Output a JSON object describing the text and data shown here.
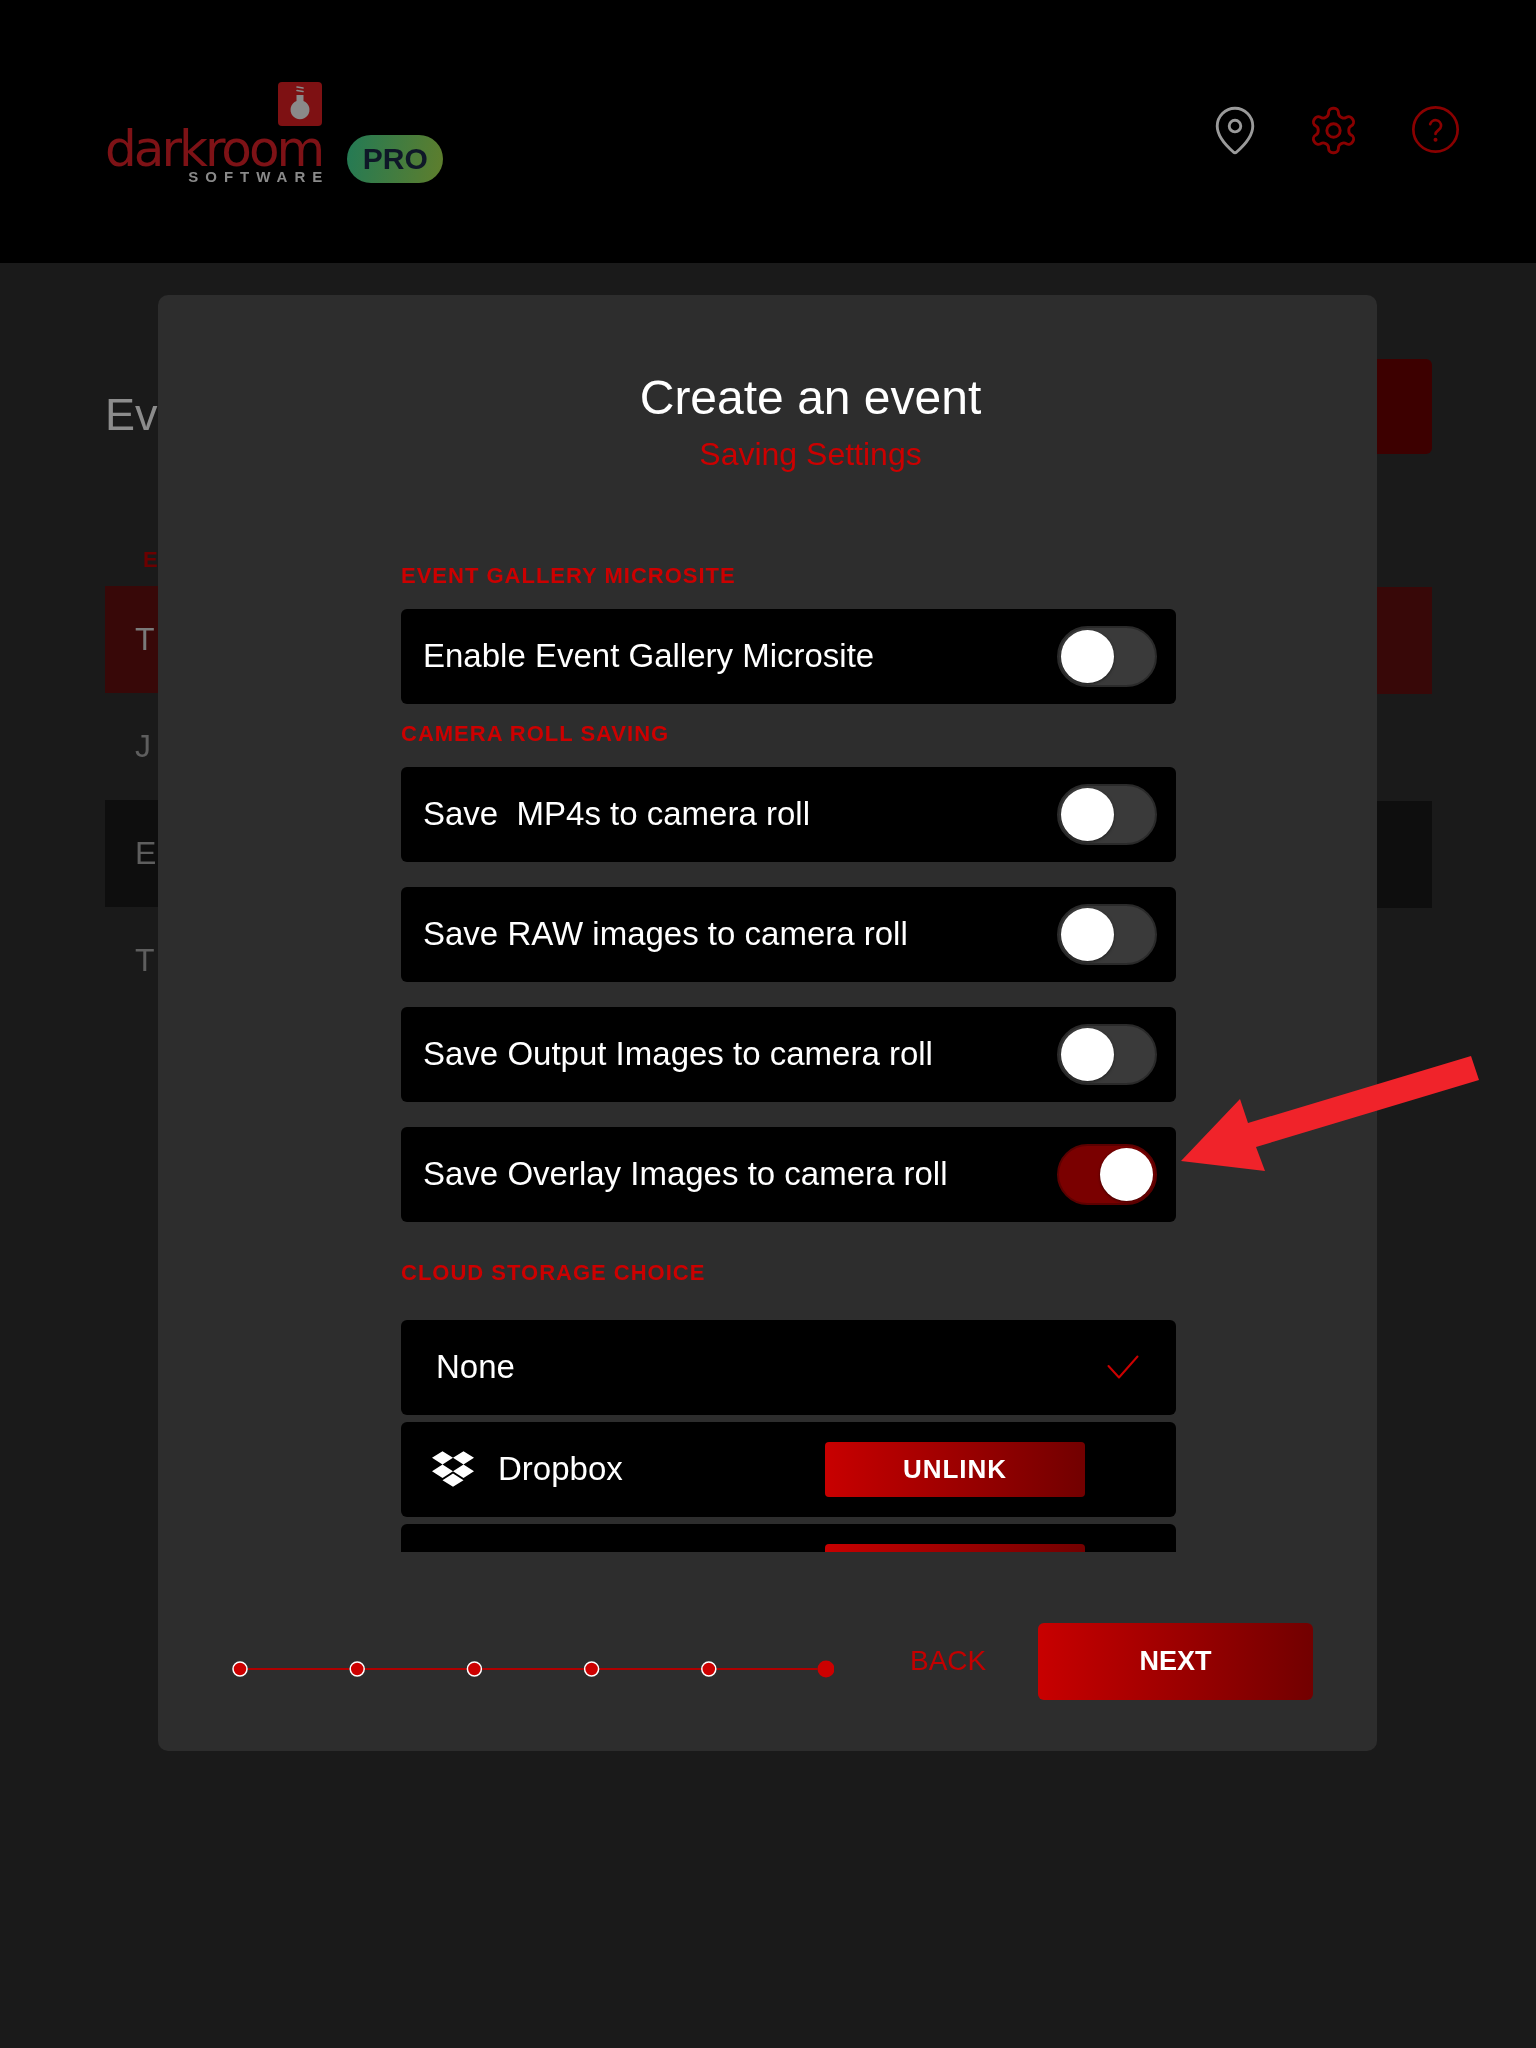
{
  "header": {
    "logo": {
      "wordmark": "darkroom",
      "tagline": "SOFTWARE"
    },
    "badge": "PRO"
  },
  "background_page": {
    "title": "Ev",
    "section_label": "E",
    "rows": [
      {
        "text": "T",
        "selected": true
      },
      {
        "text": "J",
        "selected": false
      },
      {
        "text": "E",
        "selected": false
      },
      {
        "text": "T",
        "selected": false
      }
    ]
  },
  "dialog": {
    "title": "Create an event",
    "subtitle": "Saving Settings",
    "sections": [
      {
        "heading": "EVENT GALLERY MICROSITE",
        "items": [
          {
            "kind": "toggle",
            "label": "Enable Event Gallery Microsite",
            "on": false
          }
        ]
      },
      {
        "heading": "CAMERA ROLL SAVING",
        "items": [
          {
            "kind": "toggle",
            "label": "Save  MP4s to camera roll",
            "on": false
          },
          {
            "kind": "toggle",
            "label": "Save RAW images to camera roll",
            "on": false
          },
          {
            "kind": "toggle",
            "label": "Save Output Images to camera roll",
            "on": false
          },
          {
            "kind": "toggle",
            "label": "Save Overlay Images to camera roll",
            "on": true
          }
        ]
      },
      {
        "heading": "CLOUD STORAGE CHOICE",
        "items": [
          {
            "kind": "choice",
            "label": "None",
            "selected": true
          },
          {
            "kind": "service",
            "label": "Dropbox",
            "button": "UNLINK",
            "selected": false
          },
          {
            "kind": "cut_off"
          }
        ]
      }
    ],
    "steps": [
      {
        "selected": false
      },
      {
        "selected": false
      },
      {
        "selected": false
      },
      {
        "selected": false
      },
      {
        "selected": false
      },
      {
        "selected": true
      }
    ],
    "back": "BACK",
    "next": "NEXT"
  },
  "annotations": [
    {
      "kind": "arrow"
    }
  ]
}
